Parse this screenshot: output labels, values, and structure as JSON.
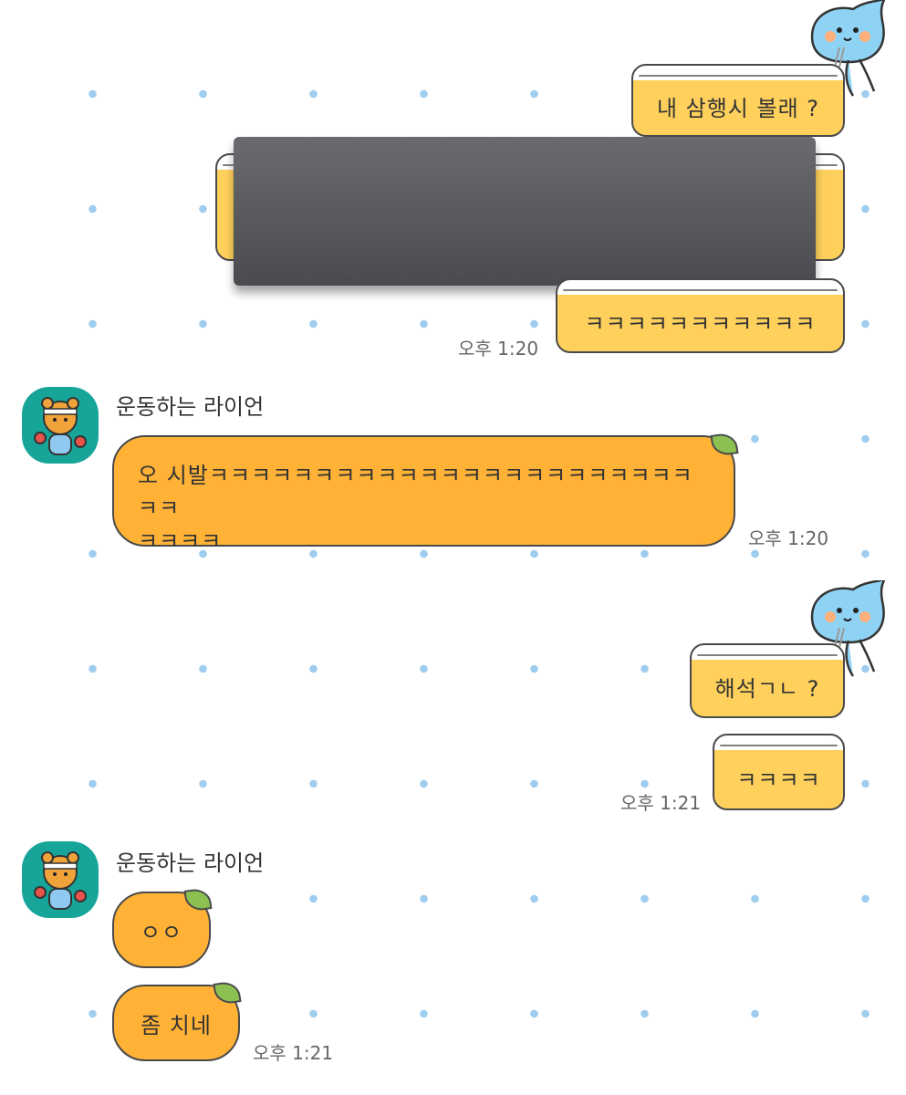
{
  "messages_out_1": {
    "bubble1": "내 삼행시 볼래 ?",
    "bubble3": "ㅋㅋㅋㅋㅋㅋㅋㅋㅋㅋㅋ",
    "time": "오후 1:20"
  },
  "message_in_1": {
    "sender": "운동하는 라이언",
    "text_line1": "오 시발ㅋㅋㅋㅋㅋㅋㅋㅋㅋㅋㅋㅋㅋㅋㅋㅋㅋㅋㅋㅋㅋㅋㅋㅋㅋ",
    "text_line2": "ㅋㅋㅋㅋ",
    "time": "오후 1:20"
  },
  "messages_out_2": {
    "bubble1": "해석ㄱㄴ ?",
    "bubble2": "ㅋㅋㅋㅋ",
    "time": "오후 1:21"
  },
  "message_in_2": {
    "sender": "운동하는 라이언",
    "bubble1": "ㅇㅇ",
    "bubble2": "좀 치네",
    "time": "오후 1:21"
  },
  "colors": {
    "jar_fill": "#ffd15c",
    "orange_bubble": "#ffb236",
    "leaf": "#8cc152",
    "avatar_bg": "#17a59a",
    "dot": "#9fcdf0"
  },
  "icons": [
    "apeach-mascot-icon",
    "ryan-avatar-icon",
    "leaf-icon"
  ]
}
